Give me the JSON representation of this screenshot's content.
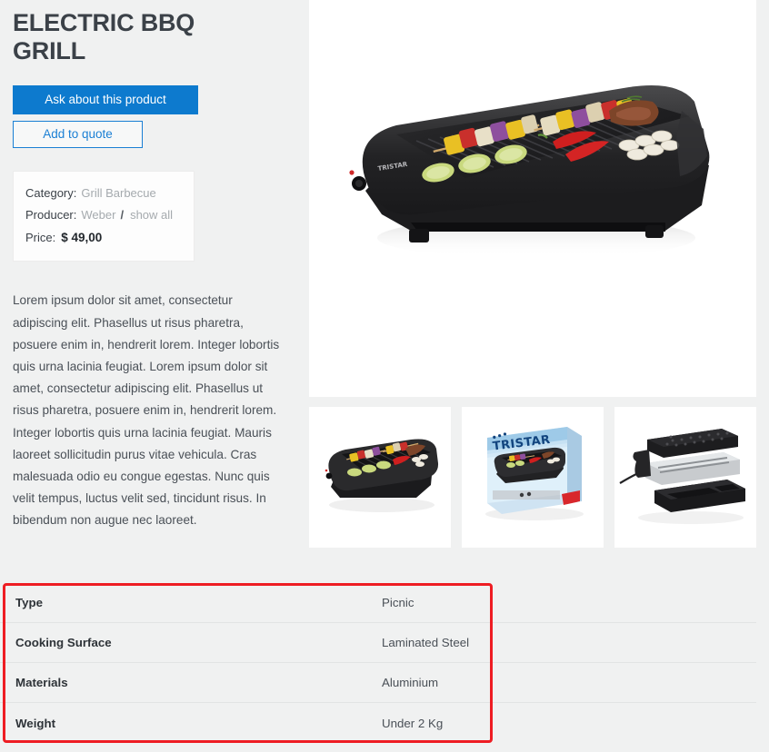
{
  "product": {
    "title": "ELECTRIC BBQ GRILL",
    "description": "Lorem ipsum dolor sit amet, consectetur adipiscing elit. Phasellus ut risus pharetra, posuere enim in, hendrerit lorem. Integer lobortis quis urna lacinia feugiat. Lorem ipsum dolor sit amet, consectetur adipiscing elit. Phasellus ut risus pharetra, posuere enim in, hendrerit lorem. Integer lobortis quis urna lacinia feugiat. Mauris laoreet sollicitudin purus vitae vehicula. Cras malesuada odio eu congue egestas. Nunc quis velit tempus, luctus velit sed, tincidunt risus. In bibendum non augue nec laoreet."
  },
  "actions": {
    "ask_label": "Ask about this product",
    "quote_label": "Add to quote"
  },
  "info": {
    "category_label": "Category:",
    "category_value": "Grill Barbecue",
    "producer_label": "Producer:",
    "producer_value": "Weber",
    "producer_separator": "/",
    "producer_show_all": "show all",
    "price_label": "Price:",
    "price_value": "$ 49,00"
  },
  "gallery": {
    "main_alt": "electric-bbq-grill-with-food-main-photo",
    "thumbs": [
      {
        "alt": "grill-with-food-thumbnail"
      },
      {
        "alt": "tristar-retail-box-thumbnail",
        "brand": "TRISTAR"
      },
      {
        "alt": "grill-disassembled-parts-thumbnail"
      }
    ]
  },
  "specs": {
    "rows": [
      {
        "key": "Type",
        "value": "Picnic"
      },
      {
        "key": "Cooking Surface",
        "value": "Laminated Steel"
      },
      {
        "key": "Materials",
        "value": "Aluminium"
      },
      {
        "key": "Weight",
        "value": "Under 2 Kg"
      }
    ]
  },
  "colors": {
    "page_background": "#f0f1f1",
    "primary_button": "#0d7ace",
    "link_blue": "#1a7fd4",
    "title_text": "#3b4148",
    "muted_text": "#a5aaae",
    "highlight_outline": "#ee1d23"
  }
}
